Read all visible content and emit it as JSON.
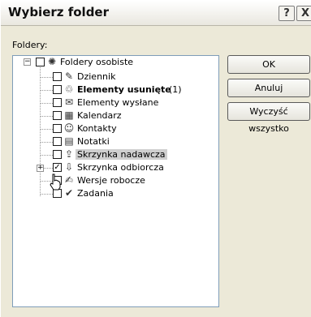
{
  "window": {
    "title": "Wybierz folder",
    "help_glyph": "?",
    "close_glyph": "X"
  },
  "folders_label": "Foldery:",
  "buttons": {
    "ok": "OK",
    "cancel": "Anuluj",
    "clear_all": "Wyczyść wszystko"
  },
  "tree": {
    "root": {
      "label": "Foldery osobiste",
      "checked": false,
      "icon": "personal-folders-icon",
      "expander": "−"
    },
    "items": [
      {
        "label": "Dziennik",
        "checked": false,
        "bold": false,
        "selected": false,
        "icon": "journal-icon"
      },
      {
        "label": "Elementy usunięte",
        "count": "(1)",
        "checked": false,
        "bold": true,
        "selected": false,
        "icon": "deleted-items-icon"
      },
      {
        "label": "Elementy wysłane",
        "checked": false,
        "bold": false,
        "selected": false,
        "icon": "sent-items-icon"
      },
      {
        "label": "Kalendarz",
        "checked": false,
        "bold": false,
        "selected": false,
        "icon": "calendar-icon"
      },
      {
        "label": "Kontakty",
        "checked": false,
        "bold": false,
        "selected": false,
        "icon": "contacts-icon"
      },
      {
        "label": "Notatki",
        "checked": false,
        "bold": false,
        "selected": false,
        "icon": "notes-icon"
      },
      {
        "label": "Skrzynka nadawcza",
        "checked": false,
        "bold": false,
        "selected": true,
        "icon": "outbox-icon"
      },
      {
        "label": "Skrzynka odbiorcza",
        "checked": true,
        "bold": false,
        "selected": false,
        "icon": "inbox-icon",
        "expander": "+"
      },
      {
        "label": "Wersje robocze",
        "checked": false,
        "bold": false,
        "selected": false,
        "icon": "drafts-icon"
      },
      {
        "label": "Zadania",
        "checked": false,
        "bold": false,
        "selected": false,
        "icon": "tasks-icon"
      }
    ]
  }
}
